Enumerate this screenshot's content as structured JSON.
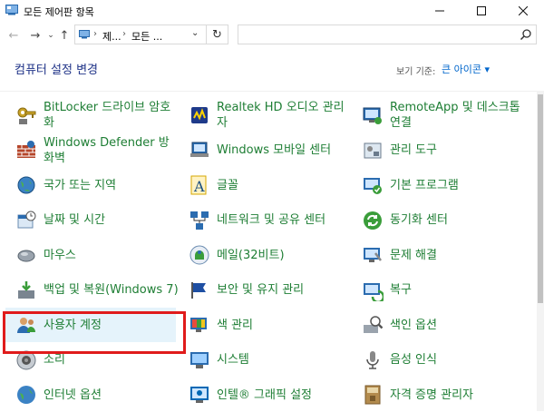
{
  "window": {
    "title": "모든 제어판 항목"
  },
  "address": {
    "crumb1": "제...",
    "crumb2": "모든 ...",
    "search_placeholder": ""
  },
  "header": {
    "title": "컴퓨터 설정 변경",
    "viewby_label": "보기 기준:",
    "viewby_value": "큰 아이콘 ▾"
  },
  "items": [
    [
      "BitLocker 드라이브 암호화",
      "Realtek HD 오디오 관리자",
      "RemoteApp 및 데스크톱 연결"
    ],
    [
      "Windows Defender 방화벽",
      "Windows 모바일 센터",
      "관리 도구"
    ],
    [
      "국가 또는 지역",
      "글꼴",
      "기본 프로그램"
    ],
    [
      "날짜 및 시간",
      "네트워크 및 공유 센터",
      "동기화 센터"
    ],
    [
      "마우스",
      "메일(32비트)",
      "문제 해결"
    ],
    [
      "백업 및 복원(Windows 7)",
      "보안 및 유지 관리",
      "복구"
    ],
    [
      "사용자 계정",
      "색 관리",
      "색인 옵션"
    ],
    [
      "소리",
      "시스템",
      "음성 인식"
    ],
    [
      "인터넷 옵션",
      "인텔® 그래픽 설정",
      "자격 증명 관리자"
    ]
  ],
  "icons": [
    [
      "bitlocker-icon",
      "realtek-audio-icon",
      "remoteapp-icon"
    ],
    [
      "firewall-icon",
      "mobility-center-icon",
      "admin-tools-icon"
    ],
    [
      "region-globe-icon",
      "fonts-icon",
      "default-programs-icon"
    ],
    [
      "date-time-icon",
      "network-center-icon",
      "sync-center-icon"
    ],
    [
      "mouse-icon",
      "mail-icon",
      "troubleshoot-icon"
    ],
    [
      "backup-restore-icon",
      "security-maintenance-icon",
      "recovery-icon"
    ],
    [
      "user-accounts-icon",
      "color-management-icon",
      "indexing-options-icon"
    ],
    [
      "sound-icon",
      "system-icon",
      "speech-recognition-icon"
    ],
    [
      "internet-options-icon",
      "intel-graphics-icon",
      "credential-manager-icon"
    ]
  ],
  "colors": {
    "link": "#1e7e34",
    "title": "#1e3287",
    "highlight": "#e01b1b",
    "selected_bg": "#e5f3fb"
  }
}
